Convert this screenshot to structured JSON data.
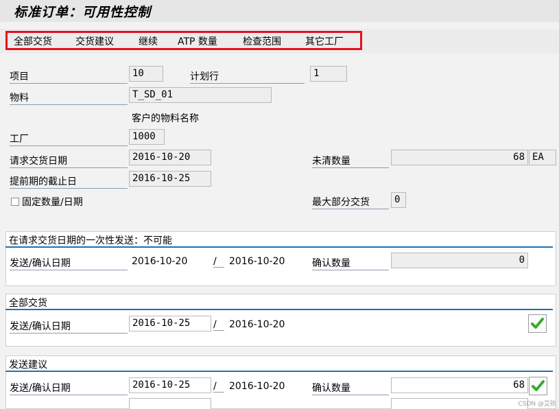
{
  "header": {
    "title": "标准订单：可用性控制"
  },
  "toolbar": {
    "items": [
      "全部交货",
      "交货建议",
      "继续",
      "ATP 数量",
      "检查范围",
      "其它工厂"
    ]
  },
  "form": {
    "item_label": "项目",
    "item_value": "10",
    "schedule_line_label": "计划行",
    "schedule_line_value": "1",
    "material_label": "物料",
    "material_value": "T_SD_01",
    "customer_material_label": "客户的物料名称",
    "plant_label": "工厂",
    "plant_value": "1000",
    "req_date_label": "请求交货日期",
    "req_date_value": "2016-10-20",
    "open_qty_label": "未清数量",
    "open_qty_value": "68",
    "open_qty_unit": "EA",
    "lead_date_label": "提前期的截止日",
    "lead_date_value": "2016-10-25",
    "fixed_qty_label": "固定数量/日期",
    "max_partial_label": "最大部分交货",
    "max_partial_value": "0"
  },
  "sections": {
    "one_time": {
      "title": "在请求交货日期的一次性发送：不可能",
      "date_label": "发送/确认日期",
      "date1": "2016-10-20",
      "sep": "/",
      "date2": "2016-10-20",
      "confirm_qty_label": "确认数量",
      "confirm_qty_value": "0"
    },
    "complete": {
      "title": "全部交货",
      "date_label": "发送/确认日期",
      "date1": "2016-10-25",
      "sep": "/",
      "date2": "2016-10-20"
    },
    "proposal": {
      "title": "发送建议",
      "date_label": "发送/确认日期",
      "date1": "2016-10-25",
      "sep": "/",
      "date2": "2016-10-20",
      "confirm_qty_label": "确认数量",
      "confirm_qty_value": "68"
    }
  },
  "watermark": "CSDN @艾砍",
  "colors": {
    "highlight": "#e8101a",
    "section_line": "#1f6fb3",
    "check": "#3aa832"
  }
}
